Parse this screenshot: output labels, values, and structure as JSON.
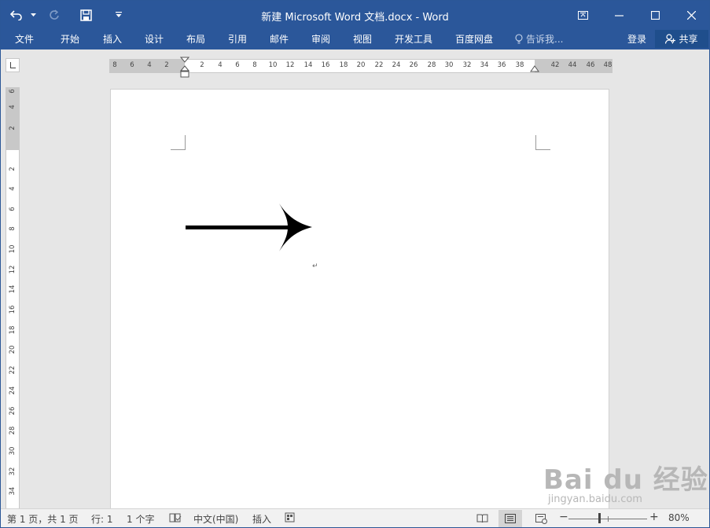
{
  "window": {
    "title": "新建 Microsoft Word 文档.docx - Word"
  },
  "quick_access": {
    "undo_icon": "undo-icon",
    "redo_icon": "redo-icon",
    "save_icon": "save-icon",
    "customize_icon": "chevron-down-icon"
  },
  "ribbon": {
    "tabs": [
      {
        "label": "文件"
      },
      {
        "label": "开始"
      },
      {
        "label": "插入"
      },
      {
        "label": "设计"
      },
      {
        "label": "布局"
      },
      {
        "label": "引用"
      },
      {
        "label": "邮件"
      },
      {
        "label": "审阅"
      },
      {
        "label": "视图"
      },
      {
        "label": "开发工具"
      },
      {
        "label": "百度网盘"
      }
    ],
    "tell_me": "告诉我...",
    "login": "登录",
    "share": "共享"
  },
  "ruler": {
    "horizontal_ticks": [
      "8",
      "6",
      "4",
      "2",
      "2",
      "4",
      "6",
      "8",
      "10",
      "12",
      "14",
      "16",
      "18",
      "20",
      "22",
      "24",
      "26",
      "28",
      "30",
      "32",
      "34",
      "36",
      "38",
      "42",
      "44",
      "46",
      "48"
    ],
    "vertical_ticks": [
      "6",
      "4",
      "2",
      "2",
      "4",
      "6",
      "8",
      "10",
      "12",
      "14",
      "16",
      "18",
      "20",
      "22",
      "24",
      "26",
      "28",
      "30",
      "32",
      "34"
    ]
  },
  "document": {
    "paragraph_mark": "↵"
  },
  "status_bar": {
    "page": "第 1 页，共 1 页",
    "line": "行: 1",
    "word_count": "1 个字",
    "language": "中文(中国)",
    "mode": "插入",
    "zoom": "80%",
    "zoom_minus": "−",
    "zoom_plus": "+"
  },
  "watermark": {
    "brand": "Bai du 经验",
    "sub": "jingyan.baidu.com"
  }
}
